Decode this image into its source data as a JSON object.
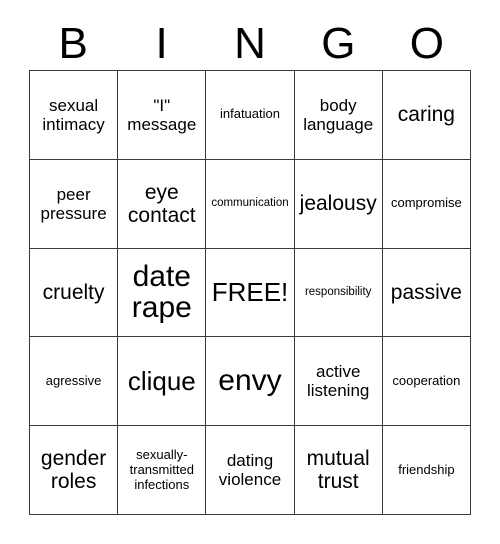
{
  "card": {
    "header_letters": [
      "B",
      "I",
      "N",
      "G",
      "O"
    ],
    "columns": 5,
    "rows": 5,
    "grid_line_color": "#3a3a3a",
    "background_color": "#ffffff",
    "text_color": "#000000",
    "free_space_label": "FREE!",
    "free_space_position": {
      "row": 3,
      "column": 3
    },
    "cells": [
      {
        "text": "sexual\nintimacy",
        "size": "fs-m"
      },
      {
        "text": "\"I\"\nmessage",
        "size": "fs-m"
      },
      {
        "text": "infatuation",
        "size": "fs-s"
      },
      {
        "text": "body\nlanguage",
        "size": "fs-m"
      },
      {
        "text": "caring",
        "size": "fs-l"
      },
      {
        "text": "peer\npressure",
        "size": "fs-m"
      },
      {
        "text": "eye\ncontact",
        "size": "fs-l"
      },
      {
        "text": "communication",
        "size": "fs-xs"
      },
      {
        "text": "jealousy",
        "size": "fs-l"
      },
      {
        "text": "compromise",
        "size": "fs-s"
      },
      {
        "text": "cruelty",
        "size": "fs-l"
      },
      {
        "text": "date\nrape",
        "size": "fs-xxl"
      },
      {
        "text": "FREE!",
        "size": "fs-xl"
      },
      {
        "text": "responsibility",
        "size": "fs-xs"
      },
      {
        "text": "passive",
        "size": "fs-l"
      },
      {
        "text": "agressive",
        "size": "fs-s"
      },
      {
        "text": "clique",
        "size": "fs-xl"
      },
      {
        "text": "envy",
        "size": "fs-xxl"
      },
      {
        "text": "active\nlistening",
        "size": "fs-m"
      },
      {
        "text": "cooperation",
        "size": "fs-s"
      },
      {
        "text": "gender\nroles",
        "size": "fs-l"
      },
      {
        "text": "sexually-\ntransmitted\ninfections",
        "size": "fs-s"
      },
      {
        "text": "dating\nviolence",
        "size": "fs-m"
      },
      {
        "text": "mutual\ntrust",
        "size": "fs-l"
      },
      {
        "text": "friendship",
        "size": "fs-s"
      }
    ]
  }
}
